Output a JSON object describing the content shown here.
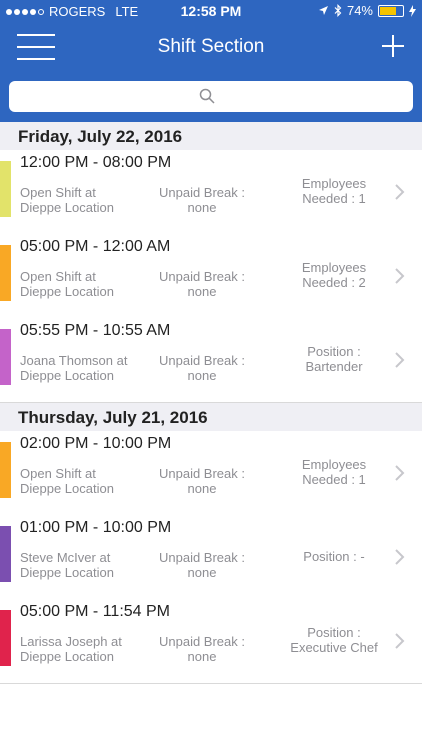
{
  "status_bar": {
    "carrier": "ROGERS",
    "network": "LTE",
    "time": "12:58 PM",
    "battery": "74%"
  },
  "navbar": {
    "title": "Shift Section"
  },
  "search": {
    "placeholder": ""
  },
  "colors": {
    "header": "#2e66c0",
    "yellow": "#e2e36a",
    "orange": "#f9a825",
    "purple": "#c463c9",
    "violet": "#7b4fb0",
    "red": "#e0234c"
  },
  "sections": [
    {
      "date": "Friday, July 22, 2016",
      "shifts": [
        {
          "time": "12:00 PM - 08:00 PM",
          "who": "Open Shift at Dieppe Location",
          "break_label": "Unpaid Break :",
          "break_value": "none",
          "info_label": "Employees Needed : 1",
          "info_value": "",
          "color": "yellow"
        },
        {
          "time": "05:00 PM - 12:00 AM",
          "who": "Open Shift at Dieppe Location",
          "break_label": "Unpaid Break :",
          "break_value": "none",
          "info_label": "Employees Needed : 2",
          "info_value": "",
          "color": "orange"
        },
        {
          "time": "05:55 PM - 10:55 AM",
          "who": "Joana Thomson at Dieppe Location",
          "break_label": "Unpaid Break :",
          "break_value": "none",
          "info_label": "Position :",
          "info_value": "Bartender",
          "color": "purple"
        }
      ]
    },
    {
      "date": "Thursday, July 21, 2016",
      "shifts": [
        {
          "time": "02:00 PM - 10:00 PM",
          "who": "Open Shift at Dieppe Location",
          "break_label": "Unpaid Break :",
          "break_value": "none",
          "info_label": "Employees Needed : 1",
          "info_value": "",
          "color": "orange"
        },
        {
          "time": "01:00 PM - 10:00 PM",
          "who": "Steve McIver at Dieppe Location",
          "break_label": "Unpaid Break :",
          "break_value": "none",
          "info_label": "Position : -",
          "info_value": "",
          "color": "violet"
        },
        {
          "time": "05:00 PM - 11:54 PM",
          "who": "Larissa Joseph at Dieppe Location",
          "break_label": "Unpaid Break :",
          "break_value": "none",
          "info_label": "Position :",
          "info_value": "Executive Chef",
          "color": "red"
        }
      ]
    }
  ]
}
